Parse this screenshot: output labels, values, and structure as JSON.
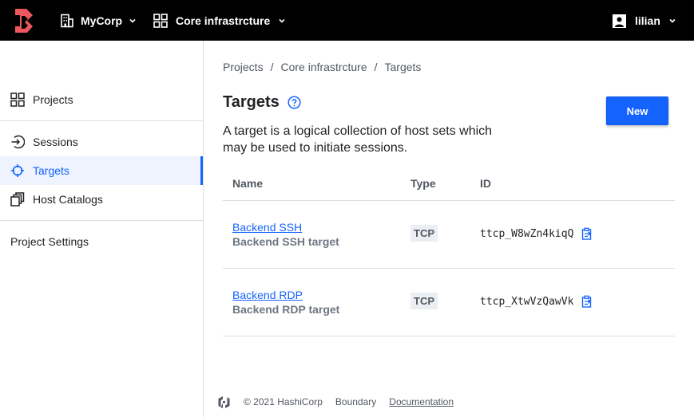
{
  "header": {
    "org": "MyCorp",
    "project": "Core infrastrcture",
    "user": "lilian"
  },
  "sidebar": {
    "items": [
      {
        "label": "Projects",
        "icon": "grid-icon"
      },
      {
        "label": "Sessions",
        "icon": "enter-icon"
      },
      {
        "label": "Targets",
        "icon": "crosshair-icon",
        "active": true
      },
      {
        "label": "Host Catalogs",
        "icon": "stack-icon"
      },
      {
        "label": "Project Settings"
      }
    ]
  },
  "breadcrumb": [
    "Projects",
    "Core infrastrcture",
    "Targets"
  ],
  "page": {
    "title": "Targets",
    "description": "A target is a logical collection of host sets which may be used to initiate sessions.",
    "new_label": "New"
  },
  "table": {
    "headers": [
      "Name",
      "Type",
      "ID"
    ],
    "rows": [
      {
        "name": "Backend SSH",
        "description": "Backend SSH target",
        "type": "TCP",
        "id": "ttcp_W8wZn4kiqQ"
      },
      {
        "name": "Backend RDP",
        "description": "Backend RDP target",
        "type": "TCP",
        "id": "ttcp_XtwVzQawVk"
      }
    ]
  },
  "footer": {
    "copyright": "© 2021 HashiCorp",
    "product": "Boundary",
    "docs": "Documentation"
  },
  "colors": {
    "accent": "#1563ff",
    "brand": "#ec585d",
    "topbar": "#000000"
  }
}
